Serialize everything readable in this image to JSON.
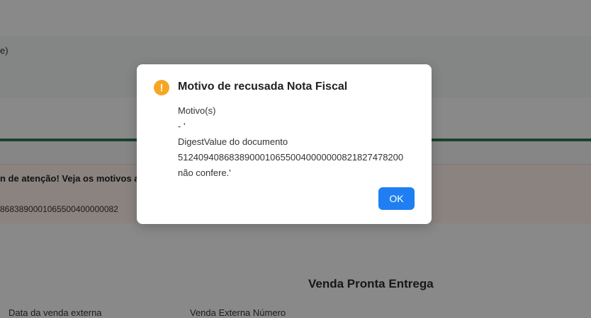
{
  "background": {
    "partial_text": "e)",
    "warning": {
      "title": "n de atenção! Veja os motivos ab",
      "code": "8683890001065500400000082"
    },
    "card": {
      "title": "Venda Pronta Entrega",
      "field_1_label": "Data da venda externa",
      "field_2_label": "Venda Externa Número"
    }
  },
  "modal": {
    "icon": "warning-icon",
    "icon_glyph": "!",
    "title": "Motivo de recusada Nota Fiscal",
    "body_lines": [
      "Motivo(s)",
      "- '",
      "DigestValue do documento",
      "51240940868389000106550040000000821827478200",
      "não confere.'"
    ],
    "ok_label": "OK"
  },
  "colors": {
    "accent": "#1f7ff2",
    "warning": "#f5a623",
    "green_bar": "#2d7a55"
  }
}
